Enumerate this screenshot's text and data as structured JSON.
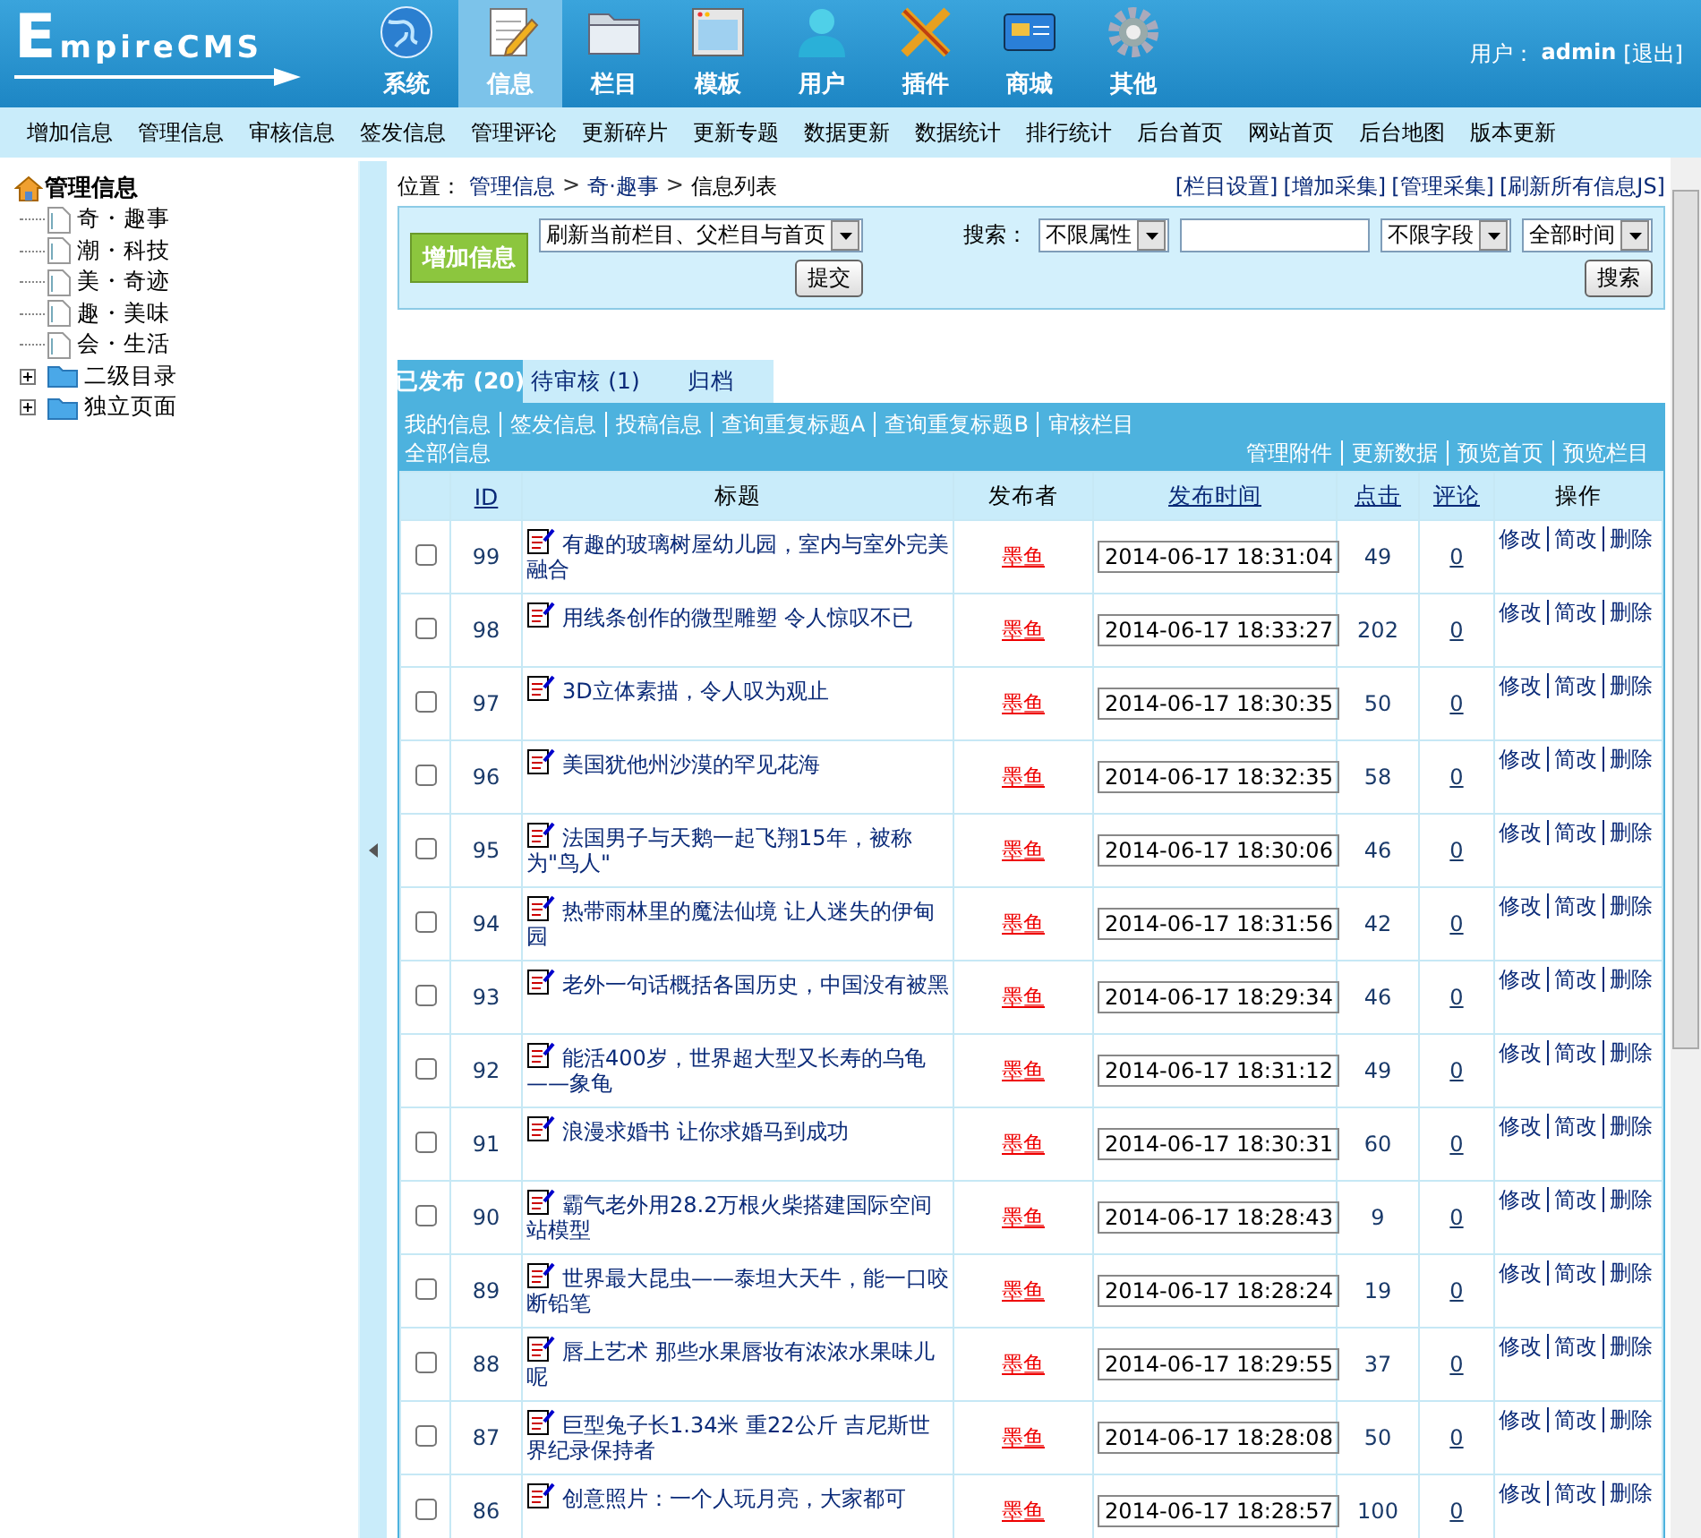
{
  "header": {
    "logo": "EmpireCMS",
    "nav": [
      {
        "label": "系统",
        "selected": false
      },
      {
        "label": "信息",
        "selected": true
      },
      {
        "label": "栏目",
        "selected": false
      },
      {
        "label": "模板",
        "selected": false
      },
      {
        "label": "用户",
        "selected": false
      },
      {
        "label": "插件",
        "selected": false
      },
      {
        "label": "商城",
        "selected": false
      },
      {
        "label": "其他",
        "selected": false
      }
    ],
    "user_label": "用户：",
    "user_name": "admin",
    "logout": "[退出]"
  },
  "submenu": [
    "增加信息",
    "管理信息",
    "审核信息",
    "签发信息",
    "管理评论",
    "更新碎片",
    "更新专题",
    "数据更新",
    "数据统计",
    "排行统计",
    "后台首页",
    "网站首页",
    "后台地图",
    "版本更新"
  ],
  "sidebar": {
    "root": "管理信息",
    "children": [
      {
        "label": "奇・趣事",
        "kind": "page"
      },
      {
        "label": "潮・科技",
        "kind": "page"
      },
      {
        "label": "美・奇迹",
        "kind": "page"
      },
      {
        "label": "趣・美味",
        "kind": "page"
      },
      {
        "label": "会・生活",
        "kind": "page"
      },
      {
        "label": "二级目录",
        "kind": "folder",
        "expanded": false
      },
      {
        "label": "独立页面",
        "kind": "folder",
        "expanded": false
      }
    ]
  },
  "breadcrumb": {
    "label": "位置：",
    "items": [
      "管理信息",
      "奇·趣事",
      "信息列表"
    ],
    "separator": ">",
    "links": [
      "[栏目设置]",
      "[增加采集]",
      "[管理采集]",
      "[刷新所有信息JS]"
    ]
  },
  "toolbar": {
    "add_button": "增加信息",
    "refresh_select": "刷新当前栏目、父栏目与首页",
    "submit_button": "提交",
    "search_label": "搜索：",
    "attr_select": "不限属性",
    "field_select": "不限字段",
    "time_select": "全部时间",
    "search_button": "搜索"
  },
  "tabs": [
    {
      "label": "已发布 (20)",
      "selected": true
    },
    {
      "label": "待审核 (1)",
      "selected": false
    },
    {
      "label": "归档",
      "selected": false
    }
  ],
  "filter_links": [
    "我的信息",
    "签发信息",
    "投稿信息",
    "查询重复标题A",
    "查询重复标题B",
    "审核栏目",
    "全部信息"
  ],
  "action_links": [
    "管理附件",
    "更新数据",
    "预览首页",
    "预览栏目"
  ],
  "table": {
    "columns": [
      {
        "label": "ID",
        "sortable": true
      },
      {
        "label": "标题",
        "sortable": false
      },
      {
        "label": "发布者",
        "sortable": false
      },
      {
        "label": "发布时间",
        "sortable": true
      },
      {
        "label": "点击",
        "sortable": true
      },
      {
        "label": "评论",
        "sortable": true
      },
      {
        "label": "操作",
        "sortable": false
      }
    ],
    "rows": [
      {
        "checked": false,
        "id": "99",
        "title": "有趣的玻璃树屋幼儿园，室内与室外完美融合",
        "author": "墨鱼",
        "time": "2014-06-17 18:31:04",
        "clicks": "49",
        "comments": "0",
        "actions": [
          "修改",
          "简改",
          "删除"
        ]
      },
      {
        "checked": false,
        "id": "98",
        "title": "用线条创作的微型雕塑 令人惊叹不已",
        "author": "墨鱼",
        "time": "2014-06-17 18:33:27",
        "clicks": "202",
        "comments": "0",
        "actions": [
          "修改",
          "简改",
          "删除"
        ]
      },
      {
        "checked": false,
        "id": "97",
        "title": "3D立体素描，令人叹为观止",
        "author": "墨鱼",
        "time": "2014-06-17 18:30:35",
        "clicks": "50",
        "comments": "0",
        "actions": [
          "修改",
          "简改",
          "删除"
        ]
      },
      {
        "checked": false,
        "id": "96",
        "title": "美国犹他州沙漠的罕见花海",
        "author": "墨鱼",
        "time": "2014-06-17 18:32:35",
        "clicks": "58",
        "comments": "0",
        "actions": [
          "修改",
          "简改",
          "删除"
        ]
      },
      {
        "checked": false,
        "id": "95",
        "title": "法国男子与天鹅一起飞翔15年，被称为\"鸟人\"",
        "author": "墨鱼",
        "time": "2014-06-17 18:30:06",
        "clicks": "46",
        "comments": "0",
        "actions": [
          "修改",
          "简改",
          "删除"
        ]
      },
      {
        "checked": false,
        "id": "94",
        "title": "热带雨林里的魔法仙境 让人迷失的伊甸园",
        "author": "墨鱼",
        "time": "2014-06-17 18:31:56",
        "clicks": "42",
        "comments": "0",
        "actions": [
          "修改",
          "简改",
          "删除"
        ]
      },
      {
        "checked": false,
        "id": "93",
        "title": "老外一句话概括各国历史，中国没有被黑",
        "author": "墨鱼",
        "time": "2014-06-17 18:29:34",
        "clicks": "46",
        "comments": "0",
        "actions": [
          "修改",
          "简改",
          "删除"
        ]
      },
      {
        "checked": false,
        "id": "92",
        "title": "能活400岁，世界超大型又长寿的乌龟——象龟",
        "author": "墨鱼",
        "time": "2014-06-17 18:31:12",
        "clicks": "49",
        "comments": "0",
        "actions": [
          "修改",
          "简改",
          "删除"
        ]
      },
      {
        "checked": false,
        "id": "91",
        "title": "浪漫求婚书 让你求婚马到成功",
        "author": "墨鱼",
        "time": "2014-06-17 18:30:31",
        "clicks": "60",
        "comments": "0",
        "actions": [
          "修改",
          "简改",
          "删除"
        ]
      },
      {
        "checked": false,
        "id": "90",
        "title": "霸气老外用28.2万根火柴搭建国际空间站模型",
        "author": "墨鱼",
        "time": "2014-06-17 18:28:43",
        "clicks": "9",
        "comments": "0",
        "actions": [
          "修改",
          "简改",
          "删除"
        ]
      },
      {
        "checked": false,
        "id": "89",
        "title": "世界最大昆虫——泰坦大天牛，能一口咬断铅笔",
        "author": "墨鱼",
        "time": "2014-06-17 18:28:24",
        "clicks": "19",
        "comments": "0",
        "actions": [
          "修改",
          "简改",
          "删除"
        ]
      },
      {
        "checked": false,
        "id": "88",
        "title": "唇上艺术 那些水果唇妆有浓浓水果味儿呢",
        "author": "墨鱼",
        "time": "2014-06-17 18:29:55",
        "clicks": "37",
        "comments": "0",
        "actions": [
          "修改",
          "简改",
          "删除"
        ]
      },
      {
        "checked": false,
        "id": "87",
        "title": "巨型兔子长1.34米 重22公斤 吉尼斯世界纪录保持者",
        "author": "墨鱼",
        "time": "2014-06-17 18:28:08",
        "clicks": "50",
        "comments": "0",
        "actions": [
          "修改",
          "简改",
          "删除"
        ]
      },
      {
        "checked": false,
        "id": "86",
        "title": "创意照片：一个人玩月亮，大家都可",
        "author": "墨鱼",
        "time": "2014-06-17 18:28:57",
        "clicks": "100",
        "comments": "0",
        "actions": [
          "修改",
          "简改",
          "删除"
        ]
      }
    ]
  }
}
